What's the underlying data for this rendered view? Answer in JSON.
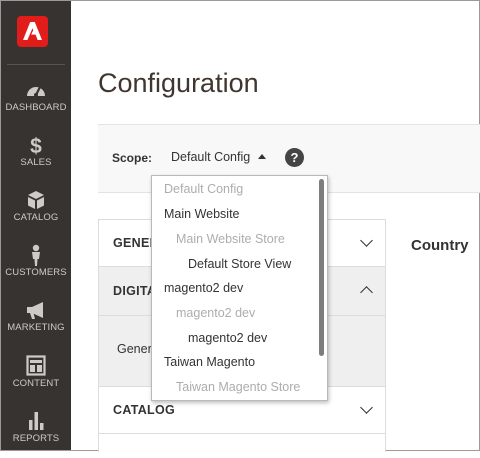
{
  "sidebar": {
    "logo": "adobe-logo",
    "items": [
      {
        "label": "DASHBOARD",
        "icon": "speedometer-icon"
      },
      {
        "label": "SALES",
        "icon": "dollar-icon"
      },
      {
        "label": "CATALOG",
        "icon": "box-icon"
      },
      {
        "label": "CUSTOMERS",
        "icon": "person-icon"
      },
      {
        "label": "MARKETING",
        "icon": "megaphone-icon"
      },
      {
        "label": "CONTENT",
        "icon": "layout-icon"
      },
      {
        "label": "REPORTS",
        "icon": "bar-chart-icon"
      }
    ]
  },
  "page": {
    "title": "Configuration"
  },
  "scope": {
    "label": "Scope:",
    "selected": "Default Config",
    "help": "?"
  },
  "dropdown": {
    "options": [
      {
        "label": "Default Config",
        "level": 0,
        "disabled": true
      },
      {
        "label": "Main Website",
        "level": 1,
        "disabled": false
      },
      {
        "label": "Main Website Store",
        "level": 2,
        "disabled": true
      },
      {
        "label": "Default Store View",
        "level": 3,
        "disabled": false
      },
      {
        "label": "magento2 dev",
        "level": 1,
        "disabled": false
      },
      {
        "label": "magento2 dev",
        "level": 2,
        "disabled": true
      },
      {
        "label": "magento2 dev",
        "level": 3,
        "disabled": false
      },
      {
        "label": "Taiwan Magento",
        "level": 1,
        "disabled": false
      },
      {
        "label": "Taiwan Magento Store",
        "level": 2,
        "disabled": true
      }
    ]
  },
  "tabs": {
    "general": "GENER",
    "digital": "DIGITA",
    "general_sub": "Gener",
    "catalog": "CATALOG"
  },
  "content": {
    "section_heading": "Country"
  },
  "colors": {
    "sidebar_bg": "#373330",
    "logo_bg": "#e21b1b",
    "disabled_option": "#adadad"
  }
}
